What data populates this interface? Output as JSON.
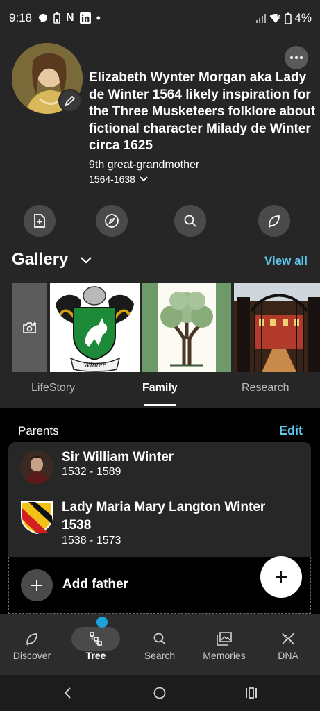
{
  "status_bar": {
    "time": "9:18",
    "battery": "4%"
  },
  "profile": {
    "name": "Elizabeth Wynter Morgan aka Lady de Winter 1564 likely inspiration for the Three Musketeers folklore about fictional character Milady de Winter circa 1625",
    "relation": "9th great-grandmother",
    "lifespan": "1564-1638"
  },
  "gallery": {
    "title": "Gallery",
    "view_all": "View all"
  },
  "tabs": [
    {
      "label": "LifeStory"
    },
    {
      "label": "Family"
    },
    {
      "label": "Research"
    }
  ],
  "parents": {
    "section_label": "Parents",
    "edit_label": "Edit",
    "people": [
      {
        "name": "Sir William Winter",
        "dates": "1532 - 1589"
      },
      {
        "name": "Lady Maria Mary Langton Winter 1538",
        "dates": "1538 - 1573"
      }
    ],
    "add_father_label": "Add father"
  },
  "bottom_nav": [
    {
      "label": "Discover",
      "icon": "leaf-chat-icon"
    },
    {
      "label": "Tree",
      "icon": "tree-icon"
    },
    {
      "label": "Search",
      "icon": "search-icon"
    },
    {
      "label": "Memories",
      "icon": "photos-icon"
    },
    {
      "label": "DNA",
      "icon": "dna-icon"
    }
  ],
  "colors": {
    "accent": "#5ec8ef",
    "background": "#262626",
    "panel": "#000000",
    "card": "#272727"
  }
}
